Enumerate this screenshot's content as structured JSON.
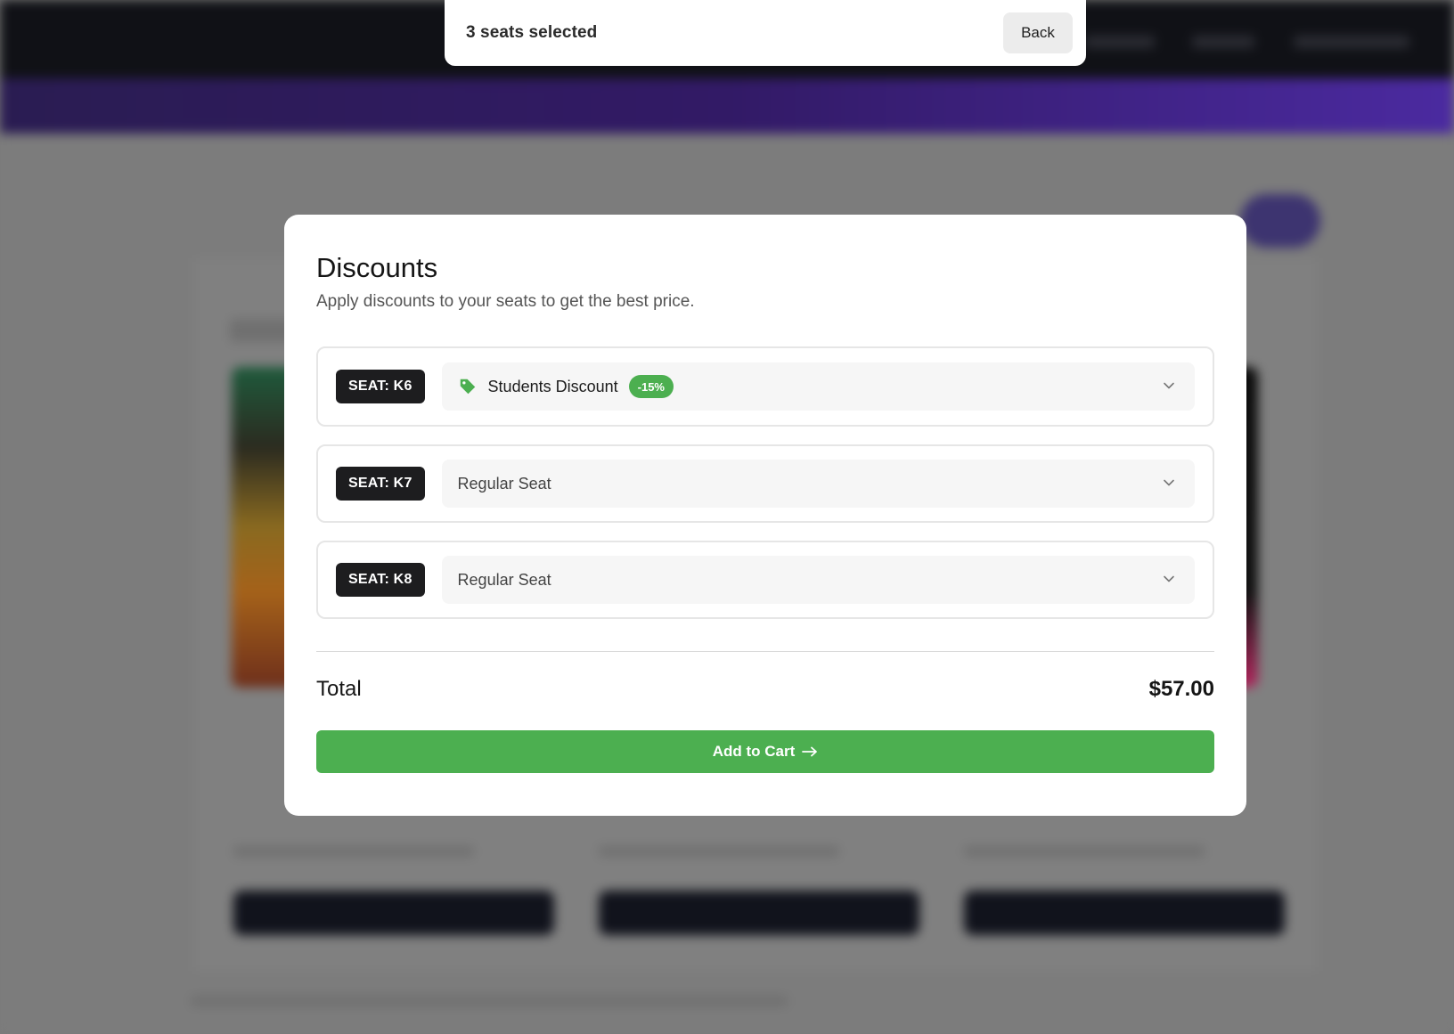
{
  "seat_bar": {
    "title": "3 seats selected",
    "back_label": "Back"
  },
  "modal": {
    "title": "Discounts",
    "subtitle": "Apply discounts to your seats to get the best price.",
    "rows": [
      {
        "seat": "SEAT: K6",
        "option": "Students Discount",
        "discount": "-15%",
        "icon": "tag-icon"
      },
      {
        "seat": "SEAT: K7",
        "option": "Regular Seat"
      },
      {
        "seat": "SEAT: K8",
        "option": "Regular Seat"
      }
    ],
    "total_label": "Total",
    "total_value": "$57.00",
    "cta_label": "Add to Cart"
  },
  "colors": {
    "accent_green": "#4caf50",
    "badge_dark": "#1d1d1f",
    "overlay": "#7b7b7b"
  }
}
